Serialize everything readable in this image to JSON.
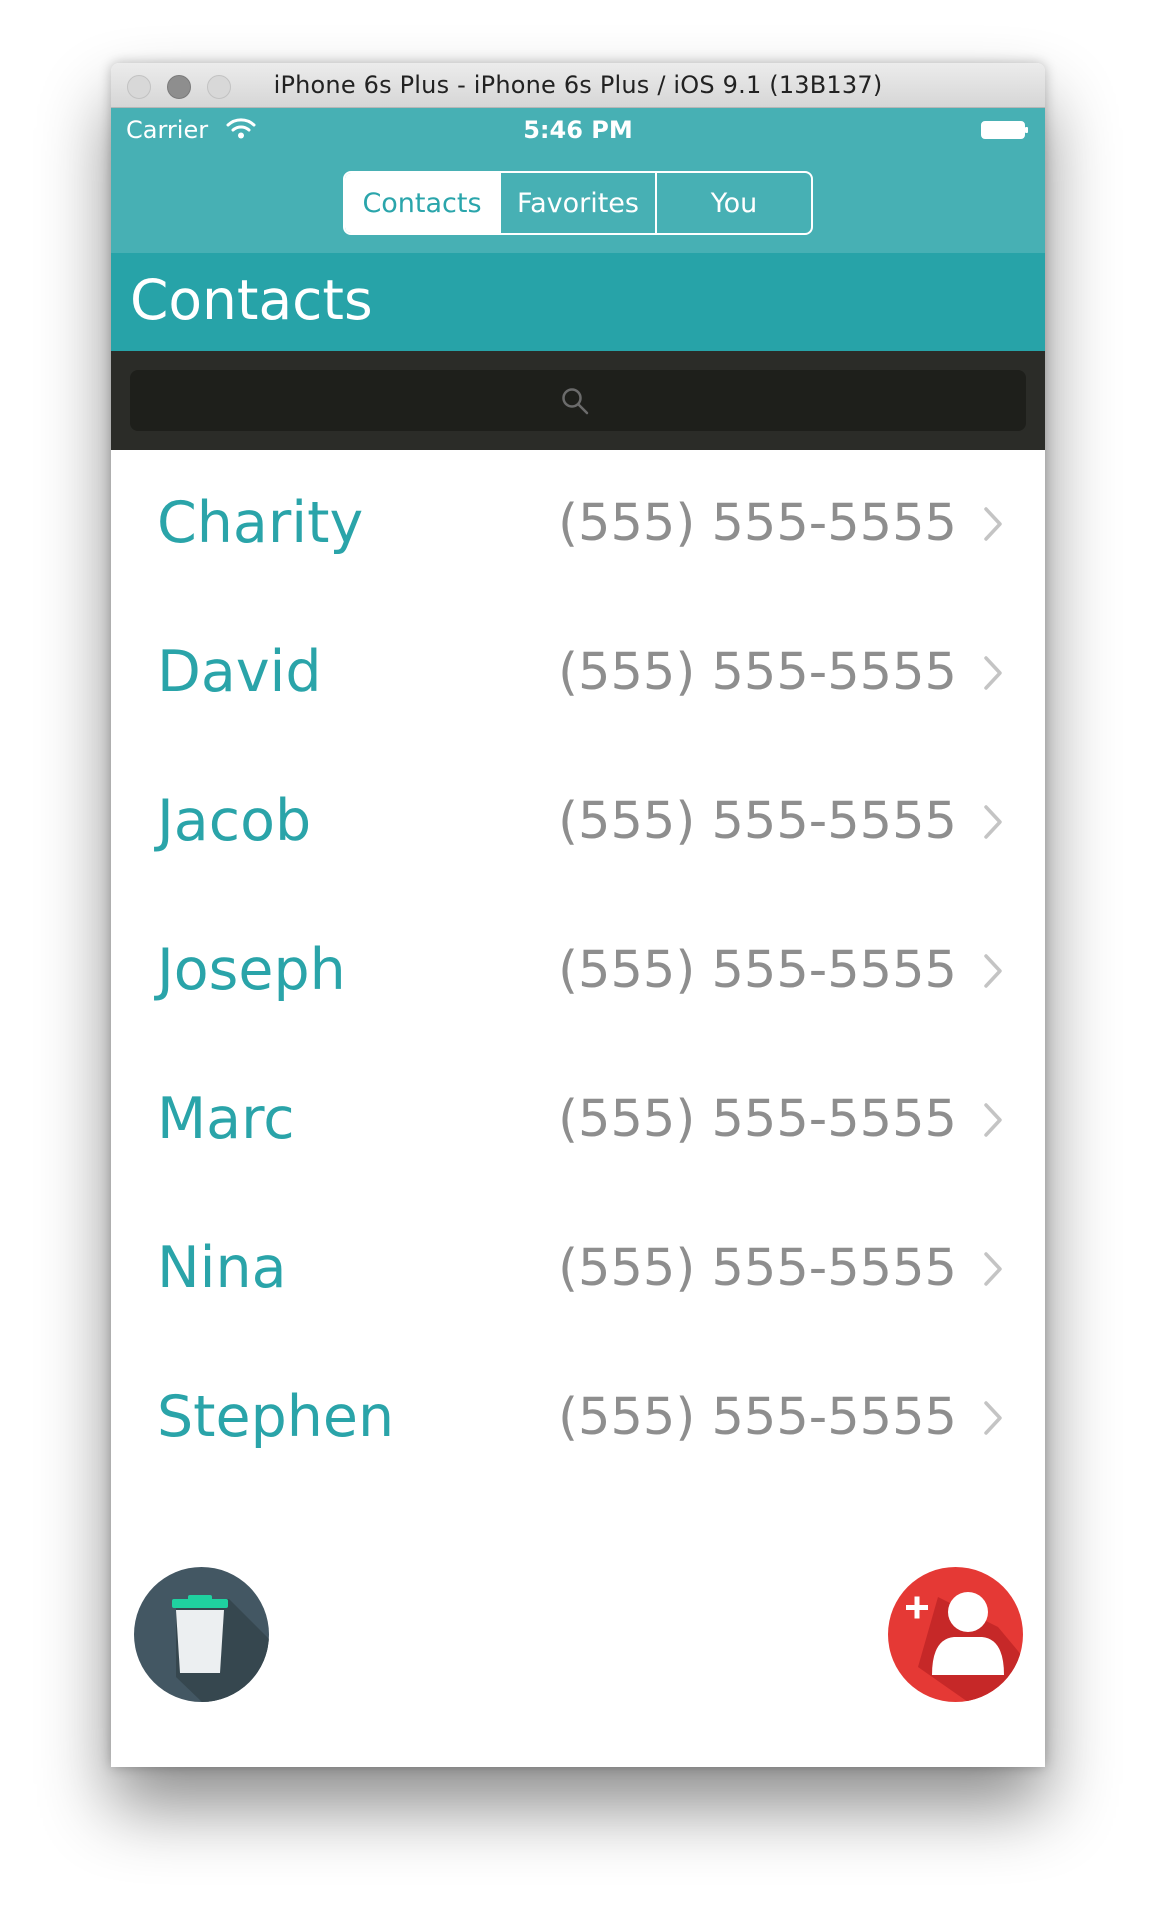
{
  "window": {
    "title": "iPhone 6s Plus - iPhone 6s Plus / iOS 9.1 (13B137)"
  },
  "status_bar": {
    "carrier": "Carrier",
    "time": "5:46 PM"
  },
  "tabs": [
    {
      "label": "Contacts",
      "active": true
    },
    {
      "label": "Favorites",
      "active": false
    },
    {
      "label": "You",
      "active": false
    }
  ],
  "header": {
    "title": "Contacts"
  },
  "contacts": [
    {
      "name": "Charity",
      "phone": "(555) 555-5555"
    },
    {
      "name": "David",
      "phone": "(555) 555-5555"
    },
    {
      "name": "Jacob",
      "phone": "(555) 555-5555"
    },
    {
      "name": "Joseph",
      "phone": "(555) 555-5555"
    },
    {
      "name": "Marc",
      "phone": "(555) 555-5555"
    },
    {
      "name": "Nina",
      "phone": "(555) 555-5555"
    },
    {
      "name": "Stephen",
      "phone": "(555) 555-5555"
    }
  ],
  "actions": {
    "delete_icon": "trash-icon",
    "add_icon": "add-contact-icon"
  },
  "colors": {
    "header_top": "#47b0b4",
    "title_bar": "#27a3a8",
    "search_bar": "#2b2c28",
    "name_text": "#2aa4a9",
    "phone_text": "#8e8e8e",
    "trash_button": "#435763",
    "add_button": "#e53935"
  }
}
